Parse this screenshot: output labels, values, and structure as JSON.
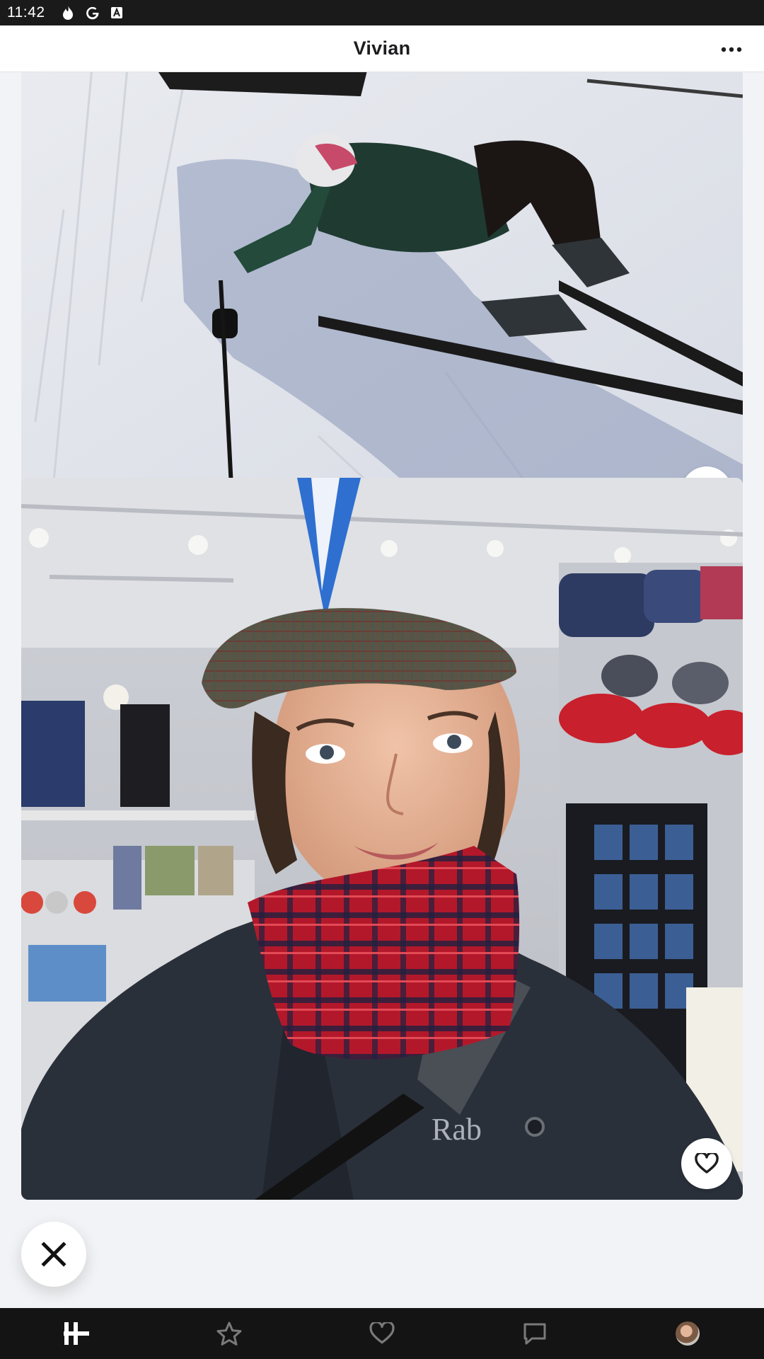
{
  "status_bar": {
    "time": "11:42",
    "icons": [
      "flame-icon",
      "google-icon",
      "font-a-icon"
    ]
  },
  "header": {
    "title": "Vivian",
    "more_icon": "more-horizontal-icon"
  },
  "cards": [
    {
      "id": "photo-1",
      "subject": "skier-lying-in-snow",
      "like_icon": "heart-outline-icon"
    },
    {
      "id": "photo-2",
      "subject": "woman-in-plaid-cap-and-scarf",
      "like_icon": "heart-outline-icon",
      "jacket_logo": "Rab"
    }
  ],
  "dismiss": {
    "icon": "close-x-icon"
  },
  "bottom_nav": {
    "items": [
      {
        "name": "home",
        "icon": "hinge-logo-icon",
        "active": true
      },
      {
        "name": "standouts",
        "icon": "star-outline-icon",
        "active": false
      },
      {
        "name": "likes",
        "icon": "heart-outline-icon",
        "active": false
      },
      {
        "name": "matches",
        "icon": "chat-bubble-icon",
        "active": false
      },
      {
        "name": "profile",
        "icon": "avatar",
        "active": false
      }
    ]
  },
  "colors": {
    "background": "#f2f3f6",
    "status_bar": "#1a1a1a",
    "nav_bar": "#141414",
    "header": "#ffffff",
    "icon_dark": "#1d1d1f",
    "icon_inactive": "#7a7a7a"
  }
}
